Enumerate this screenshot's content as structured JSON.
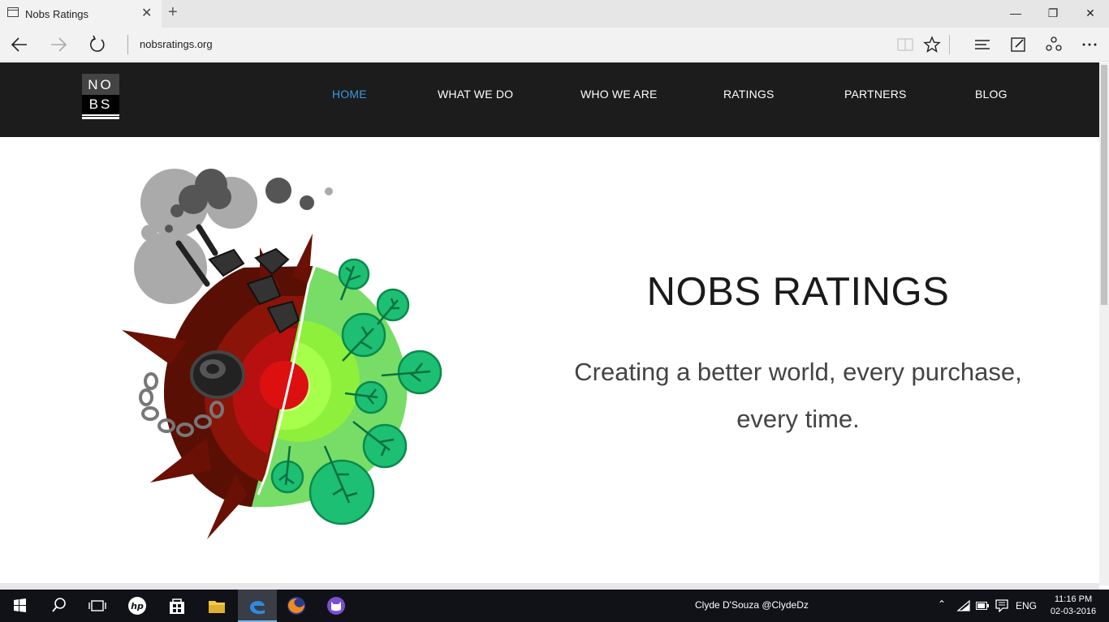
{
  "browser": {
    "tab_title": "Nobs Ratings",
    "new_tab": "+",
    "url": "nobsratings.org"
  },
  "site": {
    "logo_top": "NO",
    "logo_bottom": "BS",
    "nav": [
      {
        "label": "HOME",
        "active": true
      },
      {
        "label": "WHAT WE DO"
      },
      {
        "label": "WHO WE ARE"
      },
      {
        "label": "RATINGS"
      },
      {
        "label": "PARTNERS"
      },
      {
        "label": "BLOG"
      }
    ],
    "hero_title": "NOBS RATINGS",
    "hero_subtitle_1": "Creating a better world, every purchase,",
    "hero_subtitle_2": "every time."
  },
  "taskbar": {
    "center_text": "Clyde D'Souza @ClydeDz",
    "language": "ENG",
    "time": "11:16 PM",
    "date": "02-03-2016"
  },
  "colors": {
    "nav_active": "#3a99e0",
    "header_bg": "#1c1c1c",
    "tree_green": "#1dbf73"
  }
}
